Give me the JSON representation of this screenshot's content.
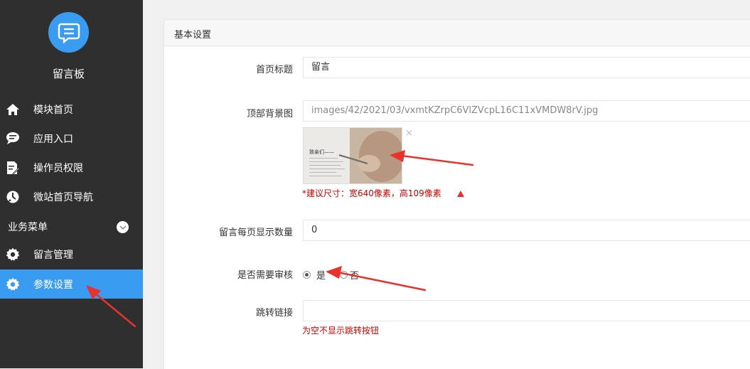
{
  "sidebar": {
    "app_title": "留言板",
    "items": [
      {
        "label": "模块首页",
        "icon": "home-icon"
      },
      {
        "label": "应用入口",
        "icon": "chat-icon"
      },
      {
        "label": "操作员权限",
        "icon": "edit-document-icon"
      },
      {
        "label": "微站首页导航",
        "icon": "compass-icon"
      }
    ],
    "section_label": "业务菜单",
    "section_items": [
      {
        "label": "留言管理",
        "icon": "gear-icon"
      },
      {
        "label": "参数设置",
        "icon": "gear-icon",
        "active": true
      }
    ]
  },
  "panel": {
    "title": "基本设置",
    "fields": {
      "home_title": {
        "label": "首页标题",
        "value": "留言"
      },
      "bg_image": {
        "label": "顶部背景图",
        "value": "images/42/2021/03/vxmtKZrpC6VlZVcpL16C11xVMDW8rV.jpg",
        "thumb_text": "致亲们——",
        "hint": "*建议尺寸：宽640像素，高109像素",
        "close_glyph": "×"
      },
      "per_page": {
        "label": "留言每页显示数量",
        "value": "0"
      },
      "need_review": {
        "label": "是否需要审核",
        "options": [
          "是",
          "否"
        ],
        "selected": "是"
      },
      "jump_link": {
        "label": "跳转链接",
        "value": "",
        "hint": "为空不显示跳转按钮"
      }
    }
  },
  "colors": {
    "sidebar_bg": "#2f2f2f",
    "accent": "#3a9cf0",
    "annotation": "#e8322b",
    "hint": "#cc0000"
  }
}
